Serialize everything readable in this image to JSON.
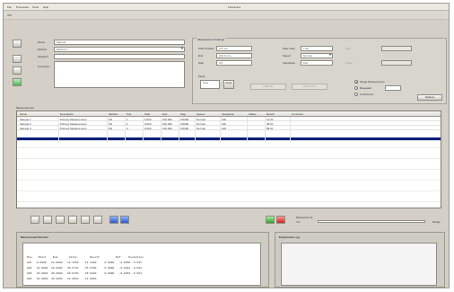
{
  "menu": [
    {
      "label": "File"
    },
    {
      "label": "Processes"
    },
    {
      "label": "Tools"
    },
    {
      "label": "Help"
    }
  ],
  "app_title": "Instrument",
  "logo_text": "INS",
  "form": {
    "name_label": "Name",
    "name_value": "Sample",
    "method_label": "Method",
    "method_value": "Method 1",
    "operator_label": "Operator",
    "operator_value": "",
    "comment_label": "Comment"
  },
  "settings": {
    "title": "Measurement Settings",
    "start_label": "Start Position",
    "start_value": "0.0 mm",
    "end_label": "End",
    "end_value": "100.0 mm",
    "step_label": "Step",
    "step_value": "0.5",
    "filter_label": "Filter Gain",
    "filter_value": "1.00",
    "speed_label": "Speed",
    "speed_value": "Normal",
    "integration_label": "Integration",
    "integration_value": "100",
    "mode_label": "Mode",
    "mode_value": "Auto",
    "apply_label": "Apply",
    "disabled_btn1": "Calibrate",
    "disabled_btn2": "Reference",
    "disabled_label1": "Gain",
    "disabled_label2": "Offset",
    "option1": "Single Measurement",
    "option2": "Repeated",
    "option3": "Continuous",
    "options_btn": "Options"
  },
  "table": {
    "section_label": "Measurements",
    "columns": [
      "Name",
      "Description",
      "Method",
      "Pos.",
      "Start",
      "End",
      "Step",
      "Speed",
      "Integration",
      "Status",
      "Result",
      "Comment"
    ],
    "rows": [
      {
        "cells": [
          "Sample 1",
          "Primary Measurement",
          "M1",
          "1",
          "0.000",
          "100.000",
          "0.5000",
          "Normal",
          "100",
          "",
          "12.34"
        ],
        "selected": false
      },
      {
        "cells": [
          "Sample 2",
          "Primary Measurement",
          "M1",
          "2",
          "0.000",
          "100.000",
          "0.5000",
          "Normal",
          "100",
          "",
          "45.67"
        ],
        "selected": false
      },
      {
        "cells": [
          "Sample 3",
          "Primary Measurement",
          "M1",
          "3",
          "0.000",
          "100.000",
          "0.5000",
          "Normal",
          "100",
          "",
          "89.01"
        ],
        "selected": false
      },
      {
        "cells": [
          "",
          "",
          "",
          "",
          "",
          "",
          "",
          "",
          "",
          "",
          ""
        ],
        "selected": true
      }
    ]
  },
  "status": {
    "progress_label": "Measurement",
    "progress_sub": "Idle",
    "right_text": "Ready"
  },
  "results": {
    "title": "Measurement Results",
    "lines": [
      "Pos.   Start    End       Value        Result          Ref     Deviation",
      "001   0.0000   10.0000   12.3456    12.3400     0.0000   -0.0056 -0.045",
      "002   10.0000  20.0000   45.6712    45.6700     0.0000   -0.0012 -0.003",
      "003   20.0000  30.0000   89.0134    89.0100     0.0000   -0.0034 -0.004",
      "004   30.0000  40.0000   12.0011    12.0000"
    ]
  },
  "log": {
    "title": "Experiment Log"
  }
}
